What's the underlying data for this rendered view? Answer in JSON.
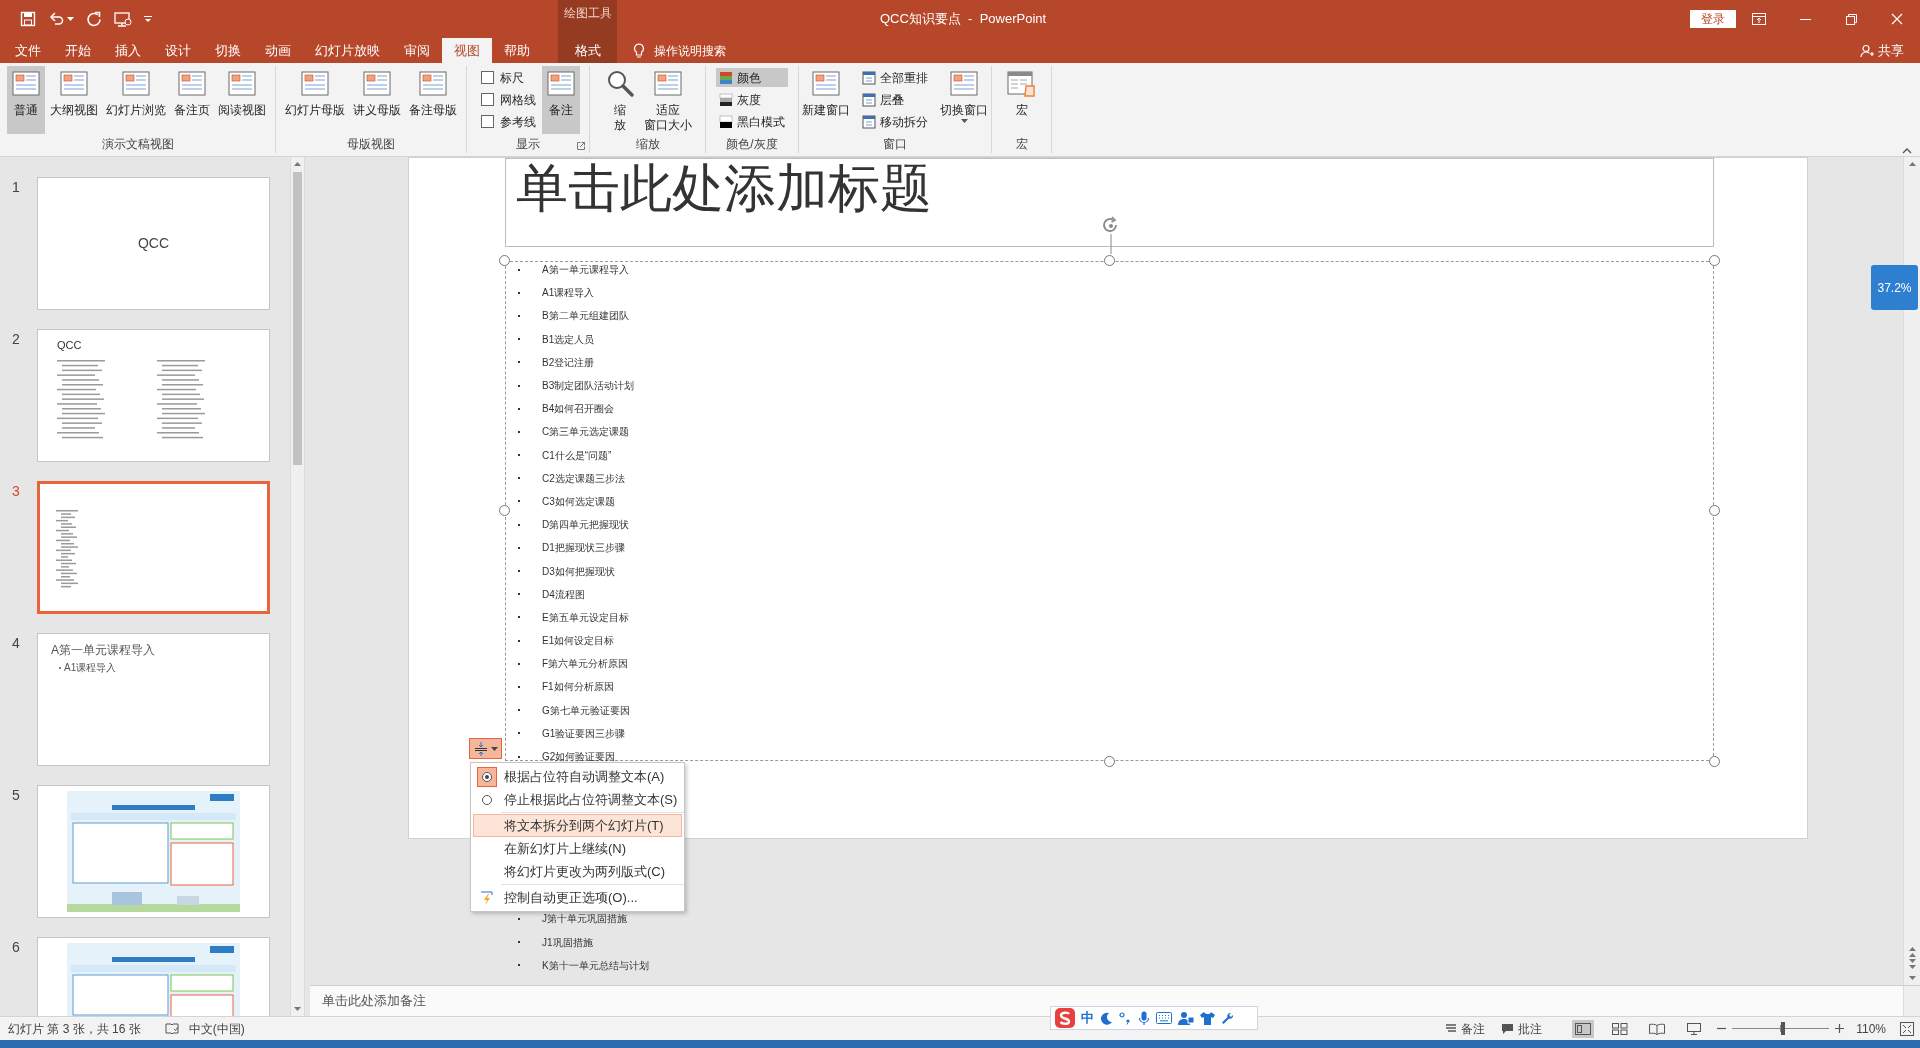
{
  "window": {
    "title": "QCC知识要点  -  PowerPoint",
    "context_group": "绘图工具",
    "sign_in": "登录"
  },
  "tabs": [
    {
      "label": "文件",
      "selected": false
    },
    {
      "label": "开始",
      "selected": false
    },
    {
      "label": "插入",
      "selected": false
    },
    {
      "label": "设计",
      "selected": false
    },
    {
      "label": "切换",
      "selected": false
    },
    {
      "label": "动画",
      "selected": false
    },
    {
      "label": "幻灯片放映",
      "selected": false
    },
    {
      "label": "审阅",
      "selected": false
    },
    {
      "label": "视图",
      "selected": true
    },
    {
      "label": "帮助",
      "selected": false
    }
  ],
  "context_tabs": [
    {
      "label": "格式",
      "selected": false
    }
  ],
  "tell_me": "操作说明搜索",
  "share": "共享",
  "ribbon": [
    {
      "label": "演示文稿视图",
      "controls": [
        {
          "kind": "large",
          "lines": [
            "普通"
          ],
          "selected": true
        },
        {
          "kind": "large",
          "lines": [
            "大纲视图"
          ],
          "selected": false
        },
        {
          "kind": "large",
          "lines": [
            "幻灯片浏览"
          ],
          "selected": false
        },
        {
          "kind": "large",
          "lines": [
            "备注页"
          ],
          "selected": false
        },
        {
          "kind": "large",
          "lines": [
            "阅读视图"
          ],
          "selected": false
        }
      ]
    },
    {
      "label": "母版视图",
      "controls": [
        {
          "kind": "large",
          "lines": [
            "幻灯片母版"
          ],
          "selected": false
        },
        {
          "kind": "large",
          "lines": [
            "讲义母版"
          ],
          "selected": false
        },
        {
          "kind": "large",
          "lines": [
            "备注母版"
          ],
          "selected": false
        }
      ]
    },
    {
      "label": "显示",
      "launcher": true,
      "controls": [
        {
          "kind": "check",
          "label": "标尺",
          "checked": false
        },
        {
          "kind": "check",
          "label": "网格线",
          "checked": false
        },
        {
          "kind": "check",
          "label": "参考线",
          "checked": false
        },
        {
          "kind": "large",
          "lines": [
            "备注"
          ],
          "selected": true
        }
      ]
    },
    {
      "label": "缩放",
      "controls": [
        {
          "kind": "large",
          "lines": [
            "缩",
            "放"
          ],
          "selected": false
        },
        {
          "kind": "large",
          "lines": [
            "适应",
            "窗口大小"
          ],
          "selected": false
        }
      ]
    },
    {
      "label": "颜色/灰度",
      "controls": [
        {
          "kind": "small",
          "label": "颜色",
          "selected": true
        },
        {
          "kind": "small",
          "label": "灰度",
          "selected": false
        },
        {
          "kind": "small",
          "label": "黑白模式",
          "selected": false
        }
      ]
    },
    {
      "label": "窗口",
      "controls": [
        {
          "kind": "large",
          "lines": [
            "新建窗口"
          ],
          "selected": false
        },
        {
          "kind": "small",
          "label": "全部重排",
          "selected": false
        },
        {
          "kind": "small",
          "label": "层叠",
          "selected": false
        },
        {
          "kind": "small",
          "label": "移动拆分",
          "selected": false
        },
        {
          "kind": "large",
          "lines": [
            "切换窗口"
          ],
          "selected": false,
          "dropdown": true
        }
      ]
    },
    {
      "label": "宏",
      "controls": [
        {
          "kind": "large",
          "lines": [
            "宏"
          ],
          "selected": false
        }
      ]
    }
  ],
  "thumbnails": [
    {
      "number": "1",
      "selected": false,
      "kind": "title",
      "title": "QCC"
    },
    {
      "number": "2",
      "selected": false,
      "kind": "list",
      "title": "QCC"
    },
    {
      "number": "3",
      "selected": true,
      "kind": "lines"
    },
    {
      "number": "4",
      "selected": false,
      "kind": "heading",
      "title": "A第一单元课程导入",
      "bullets": [
        "A1课程导入"
      ]
    },
    {
      "number": "5",
      "selected": false,
      "kind": "picture"
    },
    {
      "number": "6",
      "selected": false,
      "kind": "picture"
    }
  ],
  "slide": {
    "title": "单击此处添加标题",
    "bullets": [
      "A第一单元课程导入",
      "A1课程导入",
      "B第二单元组建团队",
      "B1选定人员",
      "B2登记注册",
      "B3制定团队活动计划",
      "B4如何召开圈会",
      "C第三单元选定课题",
      "C1什么是“问题”",
      "C2选定课题三步法",
      "C3如何选定课题",
      "D第四单元把握现状",
      "D1把握现状三步骤",
      "D3如何把握现状",
      "D4流程图",
      "E第五单元设定目标",
      "E1如何设定目标",
      "F第六单元分析原因",
      "F1如何分析原因",
      "G第七单元验证要因",
      "G1验证要因三步骤",
      "G2如何验证要因"
    ],
    "bullets_below_menu": [
      "J第十单元巩固措施",
      "J1巩固措施",
      "K第十一单元总结与计划"
    ]
  },
  "autofit_menu": [
    {
      "kind": "radio",
      "label": "根据占位符自动调整文本(A)",
      "selected": true
    },
    {
      "kind": "radio",
      "label": "停止根据此占位符调整文本(S)",
      "selected": false
    },
    {
      "kind": "plain",
      "label": "将文本拆分到两个幻灯片(T)",
      "highlighted": true
    },
    {
      "kind": "plain",
      "label": "在新幻灯片上继续(N)",
      "highlighted": false
    },
    {
      "kind": "plain",
      "label": "将幻灯片更改为两列版式(C)",
      "highlighted": false
    },
    {
      "kind": "icon",
      "label": "控制自动更正选项(O)..."
    }
  ],
  "zoom_badge": "37.2%",
  "notes": {
    "placeholder": "单击此处添加备注"
  },
  "status_bar": {
    "slide_info": "幻灯片 第 3 张，共 16 张",
    "language": "中文(中国)",
    "ime_mode": "中",
    "notes": "备注",
    "comments": "批注",
    "views": [
      {
        "selected": true
      },
      {
        "selected": false
      },
      {
        "selected": false
      },
      {
        "selected": false
      }
    ],
    "zoom_slider": {
      "level": 0.52
    },
    "zoom": "110%"
  }
}
